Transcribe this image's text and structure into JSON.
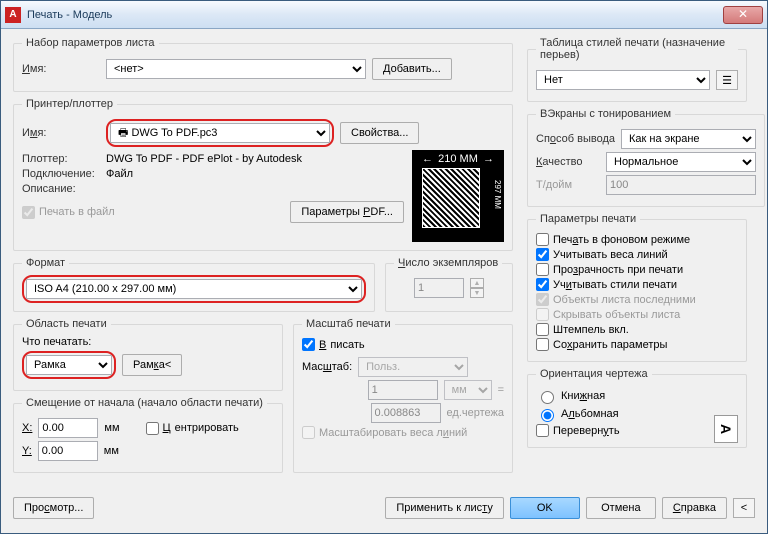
{
  "title": "Печать - Модель",
  "pageSetup": {
    "legend": "Набор параметров листа",
    "nameLabel": "Имя:",
    "nameValue": "<нет>",
    "addBtn": "Добавить..."
  },
  "printer": {
    "legend": "Принтер/плоттер",
    "nameLabel": "Имя:",
    "nameValue": "DWG To PDF.pc3",
    "propsBtn": "Свойства...",
    "plotterLabel": "Плоттер:",
    "plotterValue": "DWG To PDF - PDF ePlot - by Autodesk",
    "connLabel": "Подключение:",
    "connValue": "Файл",
    "descLabel": "Описание:",
    "toFile": "Печать в файл",
    "pdfParams": "Параметры PDF...",
    "preview": {
      "w": "210 MM",
      "h": "297 MM"
    }
  },
  "format": {
    "legend": "Формат",
    "value": "ISO A4 (210.00 x 297.00 мм)",
    "copiesLabel": "Число экземпляров",
    "copies": "1"
  },
  "area": {
    "legend": "Область печати",
    "whatLabel": "Что печатать:",
    "what": "Рамка",
    "frameBtn": "Рамка<"
  },
  "scale": {
    "legend": "Масштаб печати",
    "fit": "Вписать",
    "scaleLabel": "Масштаб:",
    "scaleValue": "Польз.",
    "num": "1",
    "unit": "мм",
    "denom": "0.008863",
    "unitLabel": "ед.чертежа",
    "scaleWeights": "Масштабировать веса линий"
  },
  "offset": {
    "legend": "Смещение от начала (начало области печати)",
    "xLabel": "X:",
    "x": "0.00",
    "yLabel": "Y:",
    "y": "0.00",
    "mm": "мм",
    "center": "Центрировать"
  },
  "styleTable": {
    "legend": "Таблица стилей печати (назначение перьев)",
    "value": "Нет"
  },
  "viewports": {
    "legend": "ВЭкраны с тонированием",
    "modeLabel": "Способ вывода",
    "mode": "Как на экране",
    "qualityLabel": "Качество",
    "quality": "Нормальное",
    "dpiLabel": "Т/дойм",
    "dpi": "100"
  },
  "options": {
    "legend": "Параметры печати",
    "bg": "Печать в фоновом режиме",
    "weights": "Учитывать веса линий",
    "transparency": "Прозрачность при печати",
    "styles": "Учитывать стили печати",
    "last": "Объекты листа последними",
    "hide": "Скрывать объекты листа",
    "stamp": "Штемпель вкл.",
    "save": "Сохранить параметры"
  },
  "orientation": {
    "legend": "Ориентация чертежа",
    "portrait": "Книжная",
    "landscape": "Альбомная",
    "reverse": "Перевернуть"
  },
  "footer": {
    "preview": "Просмотр...",
    "apply": "Применить к листу",
    "ok": "OK",
    "cancel": "Отмена",
    "help": "Справка"
  }
}
